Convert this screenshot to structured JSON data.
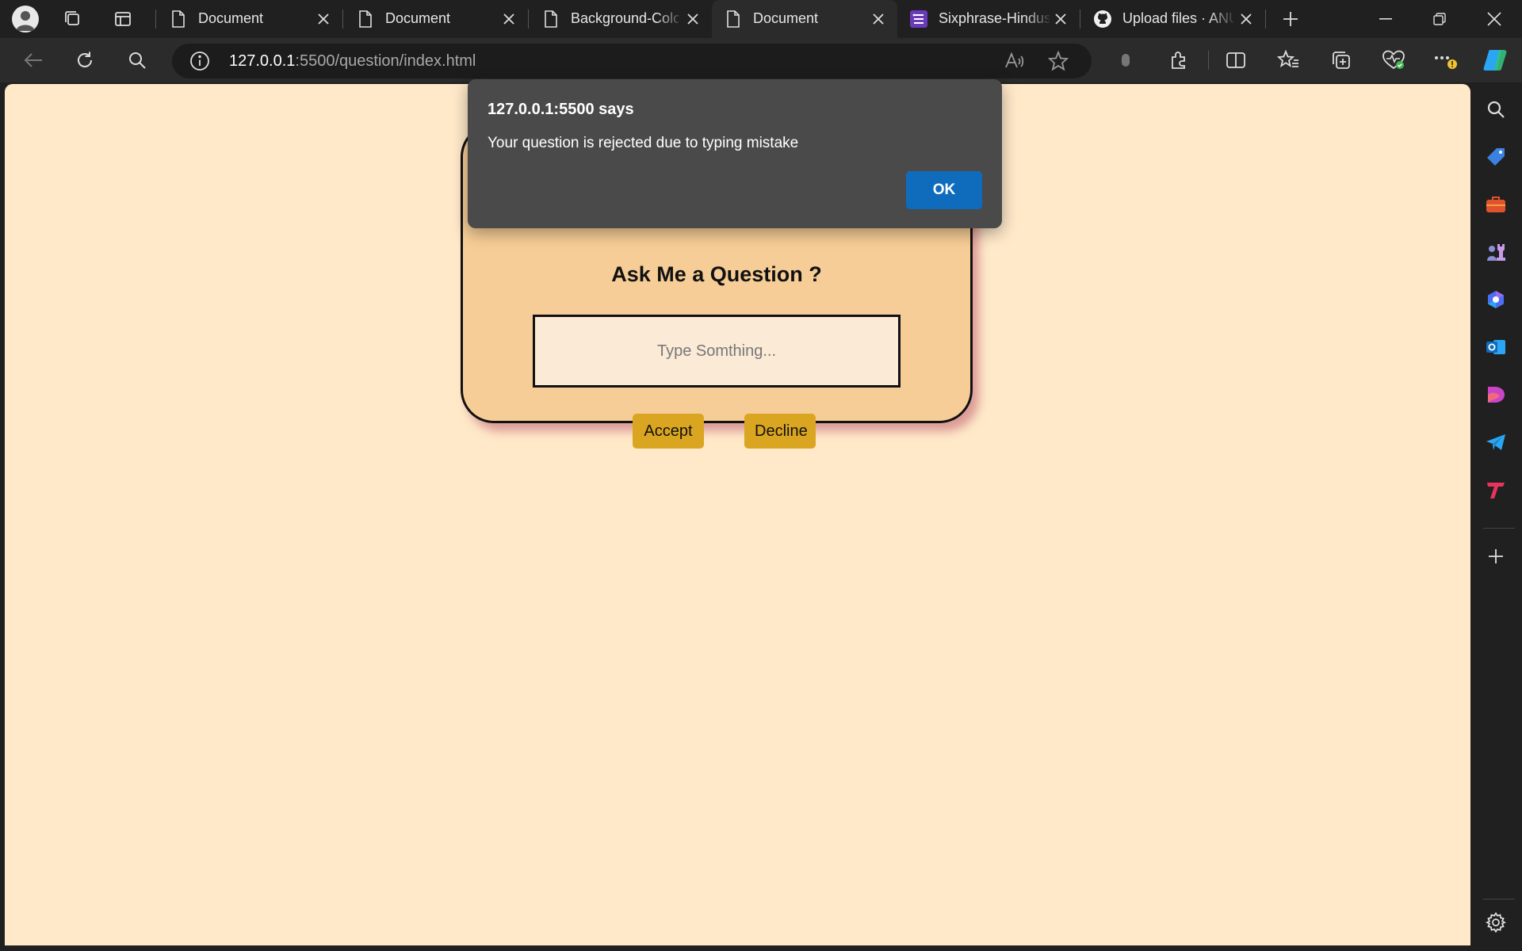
{
  "tabs": [
    {
      "title": "Document",
      "icon": "document-icon",
      "active": false
    },
    {
      "title": "Document",
      "icon": "document-icon",
      "active": false
    },
    {
      "title": "Background-Colo",
      "icon": "document-icon",
      "active": false
    },
    {
      "title": "Document",
      "icon": "document-icon",
      "active": true
    },
    {
      "title": "Sixphrase-Hindus",
      "icon": "forms-icon",
      "active": false
    },
    {
      "title": "Upload files · ANU",
      "icon": "github-icon",
      "active": false
    }
  ],
  "address": {
    "host": "127.0.0.1",
    "rest": ":5500/question/index.html"
  },
  "page": {
    "title": "Ask Me a Question ?",
    "input_placeholder": "Type Somthing...",
    "input_value": "",
    "accept_label": "Accept",
    "decline_label": "Decline"
  },
  "alert": {
    "title": "127.0.0.1:5500 says",
    "message": "Your question is rejected due to typing mistake",
    "ok_label": "OK"
  },
  "colors": {
    "page_background": "#ffe9c9",
    "card_background": "#f6cd96",
    "button_background": "#daa520",
    "alert_background": "#4a4a4a",
    "alert_button": "#0f6cbd"
  }
}
